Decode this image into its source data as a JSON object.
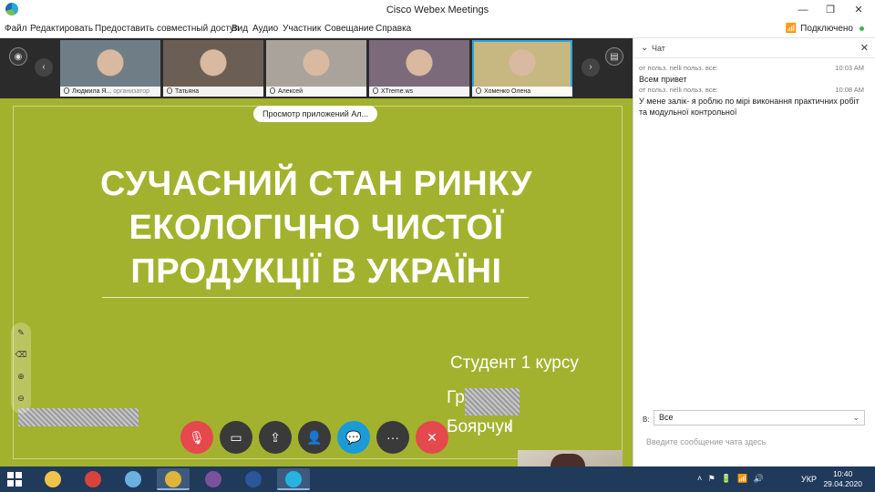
{
  "window": {
    "title": "Cisco Webex Meetings",
    "minimize_glyph": "—",
    "maximize_glyph": "❐",
    "close_glyph": "✕"
  },
  "menu": {
    "items": [
      "Файл",
      "Редактировать",
      "Предоставить совместный доступ",
      "Вид",
      "Аудио",
      "Участник",
      "Совещание",
      "Справка"
    ],
    "connection_status": "Подключено",
    "connection_color": "#3bb54a"
  },
  "participants": [
    {
      "name": "Людмила Я...",
      "role": "организатор",
      "active": false,
      "bg": "#6f7d86"
    },
    {
      "name": "Татьяна",
      "role": "",
      "active": false,
      "bg": "#6b5e55"
    },
    {
      "name": "Алексей",
      "role": "",
      "active": false,
      "bg": "#a9a39b"
    },
    {
      "name": "XTreme.ws",
      "role": "",
      "active": false,
      "bg": "#7a6a7a"
    },
    {
      "name": "Хоменко Олена",
      "role": "",
      "active": true,
      "bg": "#c7b780"
    }
  ],
  "share": {
    "pill_label": "Просмотр приложений Ал...",
    "slide_bg": "#a3b22e",
    "title_lines": [
      "СУЧАСНИЙ СТАН РИНКУ",
      "ЕКОЛОГІЧНО ЧИСТОЇ",
      "ПРОДУКЦІЇ В УКРАЇНІ"
    ],
    "student_line": "Студент 1 курсу",
    "group_line_partial": "Гр",
    "name_line_partial": "Боярчук",
    "name_line_tail": "І"
  },
  "controls": [
    {
      "name": "mute-button",
      "icon": "mic-off-icon",
      "glyph": "🎙",
      "color": "#e5484d"
    },
    {
      "name": "video-button",
      "icon": "video-icon",
      "glyph": "▭",
      "color": "#3a3a3a"
    },
    {
      "name": "share-button",
      "icon": "share-icon",
      "glyph": "⇪",
      "color": "#3a3a3a"
    },
    {
      "name": "participants-button",
      "icon": "participants-icon",
      "glyph": "👤",
      "color": "#3a3a3a"
    },
    {
      "name": "chat-button",
      "icon": "chat-icon",
      "glyph": "💬",
      "color": "#1a9bd7"
    },
    {
      "name": "more-button",
      "icon": "more-icon",
      "glyph": "···",
      "color": "#3a3a3a"
    },
    {
      "name": "leave-button",
      "icon": "close-icon",
      "glyph": "✕",
      "color": "#e5484d"
    }
  ],
  "chat": {
    "header": "Чат",
    "messages": [
      {
        "meta": "от польз. nelli польз. все:",
        "time": "10:03 AM",
        "text": "Всем привет"
      },
      {
        "meta": "от польз. nelli польз. все:",
        "time": "10:08 AM",
        "text": "У мене залік- я роблю по мірі виконання практичних робіт та модульної контрольної"
      }
    ],
    "to_label": "В:",
    "to_value": "Все",
    "input_placeholder": "Введите сообщение чата здесь"
  },
  "taskbar": {
    "apps": [
      {
        "name": "file-explorer-icon",
        "color": "#f1c24b",
        "active": false
      },
      {
        "name": "headphones-app-icon",
        "color": "#d9443a",
        "active": false
      },
      {
        "name": "paint-icon",
        "color": "#6bb1e0",
        "active": false
      },
      {
        "name": "chrome-icon",
        "color": "#e0b43a",
        "active": true
      },
      {
        "name": "viber-icon",
        "color": "#7b519d",
        "active": false
      },
      {
        "name": "word-icon",
        "color": "#2b579a",
        "active": false
      },
      {
        "name": "webex-icon",
        "color": "#27b3e0",
        "active": true
      }
    ],
    "tray_glyphs": "˄ ⚑ 🔋 📶 🔊",
    "language": "УКР",
    "time": "10:40",
    "date": "29.04.2020"
  }
}
